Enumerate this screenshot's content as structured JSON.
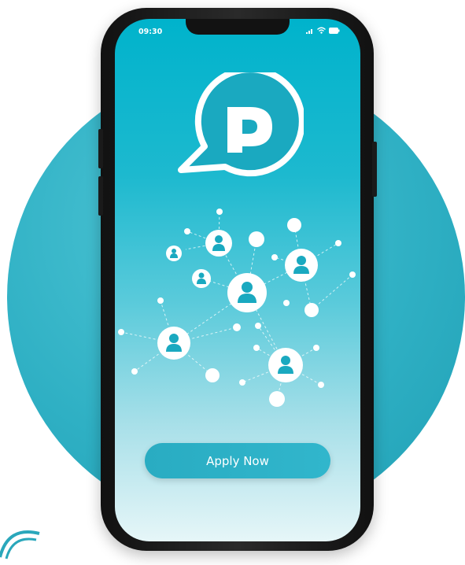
{
  "status_bar": {
    "time": "09:30"
  },
  "main": {
    "apply_button_label": "Apply Now"
  },
  "logo": {
    "letter": "P"
  },
  "colors": {
    "brand": "#00b3cc",
    "button": "#2fb0c4",
    "background_circle": "#2fb0c4"
  }
}
